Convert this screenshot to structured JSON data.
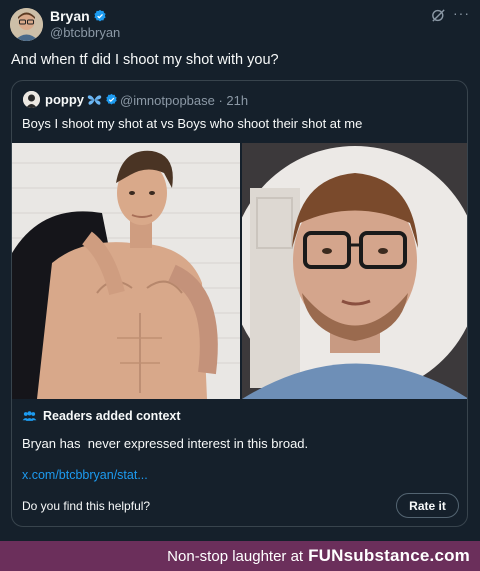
{
  "post": {
    "author_name": "Bryan",
    "author_handle": "@btcbbryan",
    "text": "And when tf did I shoot my shot with you?",
    "grok_icon": "grok-icon",
    "more_icon": "more-icon"
  },
  "quote": {
    "author_name": "poppy",
    "author_handle": "@imnotpopbase · 21h",
    "text": "Boys I shoot my shot at vs Boys who shoot their shot at me",
    "images": [
      {
        "name": "shirtless-man-photo"
      },
      {
        "name": "man-with-glasses-photo"
      }
    ]
  },
  "community_note": {
    "heading": "Readers added context",
    "text": "Bryan has  never expressed interest in this broad.",
    "link": "x.com/btcbbryan/stat...",
    "helpful_prompt": "Do you find this helpful?",
    "rate_label": "Rate it"
  },
  "footer": {
    "text": "Non-stop laughter at",
    "brand": "FUNsubstance.com"
  },
  "colors": {
    "background": "#15202b",
    "verified": "#1d9bf0",
    "link": "#1d9bf0",
    "footer_bg": "#6b2f5b"
  }
}
